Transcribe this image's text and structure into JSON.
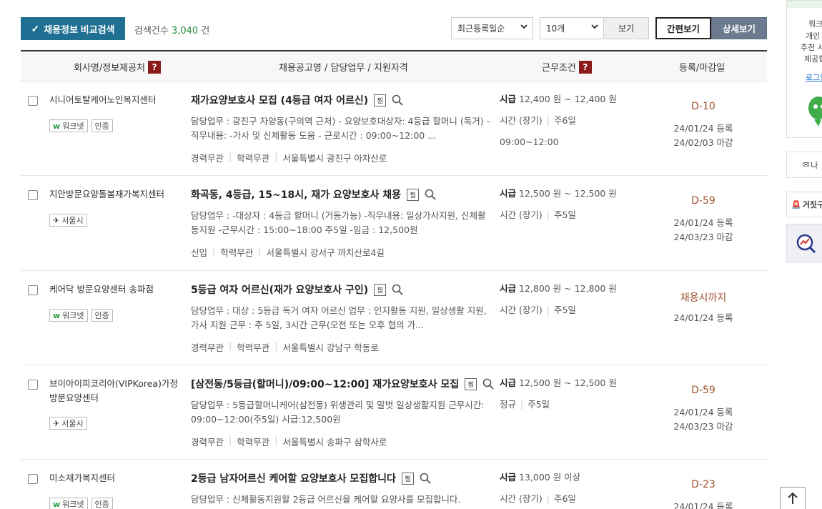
{
  "toolbar": {
    "compare_label": "채용정보 비교검색",
    "count_prefix": "검색건수",
    "count_value": "3,040",
    "count_suffix": "건",
    "sort_selected": "최근등록일순",
    "page_size_selected": "10개",
    "view_label": "보기",
    "mode_simple": "간편보기",
    "mode_detail": "상세보기"
  },
  "header": {
    "company": "회사명/정보제공처",
    "title": "채용공고명 / 담당업무 / 지원자격",
    "conditions": "근무조건",
    "date": "등록/마감일"
  },
  "rows": [
    {
      "company_lines": [
        "시니어토탈케어노인복지센터"
      ],
      "badges": [
        "워크넷",
        "인증"
      ],
      "title": "재가요양보호사 모집 (4등급 여자 어르신)",
      "duty_lines": [
        "담당업무 : 광진구 자양동(구의역 근처) - 요양보호대상자: 4등급 할머니 (독거) -",
        "직무내용: -가사 및 신체활동 도움 - 근로시간 : 09:00~12:00 ..."
      ],
      "quals": [
        "경력무관",
        "학력무관",
        "서울특별시 광진구 아차산로"
      ],
      "pay_type": "시급",
      "pay": "12,400 원 ~ 12,400 원",
      "cond_a": "시간 (장기)",
      "cond_b": "주6일",
      "cond_extra": "09:00~12:00",
      "dday": "D-10",
      "registered": "24/01/24 등록",
      "deadline": "24/02/03 마감"
    },
    {
      "company_lines": [
        "지안방문요양돌봄재가복지센터"
      ],
      "badges": [
        "서울시"
      ],
      "title": "화곡동, 4등급, 15~18시, 재가 요양보호사 채용",
      "duty_lines": [
        "담당업무 : -대상자 : 4등급 할머니 (거동가능) -직무내용: 일상가사지원, 신체활",
        "동지원 -근무시간 : 15:00~18:00 주5일 -임금 : 12,500원"
      ],
      "quals": [
        "신입",
        "학력무관",
        "서울특별시 강서구 까치산로4길"
      ],
      "pay_type": "시급",
      "pay": "12,500 원 ~ 12,500 원",
      "cond_a": "시간 (장기)",
      "cond_b": "주5일",
      "cond_extra": "",
      "dday": "D-59",
      "registered": "24/01/24 등록",
      "deadline": "24/03/23 마감"
    },
    {
      "company_lines": [
        "케어닥 방문요양센터 송파점"
      ],
      "badges": [
        "워크넷",
        "인증"
      ],
      "title": "5등급 여자 어르신(재가 요양보호사 구인)",
      "duty_lines": [
        "담당업무 : 대상 : 5등급 독거 여자 어르신 업무 : 인지활동 지원, 일상생활 지원,",
        "가사 지원 근무 : 주 5일, 3시간 근무(오전 또는 오후 협의 가..."
      ],
      "quals": [
        "경력무관",
        "학력무관",
        "서울특별시 강남구 학동로"
      ],
      "pay_type": "시급",
      "pay": "12,800 원 ~ 12,800 원",
      "cond_a": "시간 (장기)",
      "cond_b": "주5일",
      "cond_extra": "",
      "dday": "채용시까지",
      "registered": "24/01/24 등록",
      "deadline": ""
    },
    {
      "company_lines": [
        "브이아이피코리아(VIPKorea)가정",
        "방문요양센터"
      ],
      "badges": [
        "서울시"
      ],
      "title": "[삼전동/5등급(할머니)/09:00~12:00] 재가요양보호사 모집",
      "duty_lines": [
        "담당업무 : 5등급할머니케어(삼전동) 위생관리 및 말벗 일상생활지원 근무시간:",
        "09:00~12:00(주5일) 시급:12,500원"
      ],
      "quals": [
        "경력무관",
        "학력무관",
        "서울특별시 송파구 삼학사로"
      ],
      "pay_type": "시급",
      "pay": "12,500 원 ~ 12,500 원",
      "cond_a": "정규",
      "cond_b": "주5일",
      "cond_extra": "",
      "dday": "D-59",
      "registered": "24/01/24 등록",
      "deadline": "24/03/23 마감"
    },
    {
      "company_lines": [
        "미소재가복지센터"
      ],
      "badges": [
        "워크넷",
        "인증"
      ],
      "title": "2등급 남자어르신 케어할 요양보호사 모집합니다",
      "duty_lines": [
        "담당업무 : 신체활동지원할 2등급 어르신을 케어할 요양사를 모집합니다."
      ],
      "quals": [],
      "pay_type": "시급",
      "pay": "13,000 원 이상",
      "cond_a": "시간 (장기)",
      "cond_b": "주6일",
      "cond_extra": "",
      "dday": "D-23",
      "registered": "24/01/24 등록",
      "deadline": ""
    }
  ],
  "icons": {
    "scrap": "스크랩",
    "search": "magnifier-icon"
  },
  "sidebar": {
    "line1": "워크",
    "line2": "개인",
    "line3": "추천 서",
    "line4": "제공합",
    "login": "로그인",
    "mail": "나",
    "alert": "거짓구"
  },
  "colors": {
    "accent": "#1f6f93",
    "dday": "#a0522d",
    "help_badge": "#8b1a1a",
    "detail_button": "#6b7a8f"
  }
}
